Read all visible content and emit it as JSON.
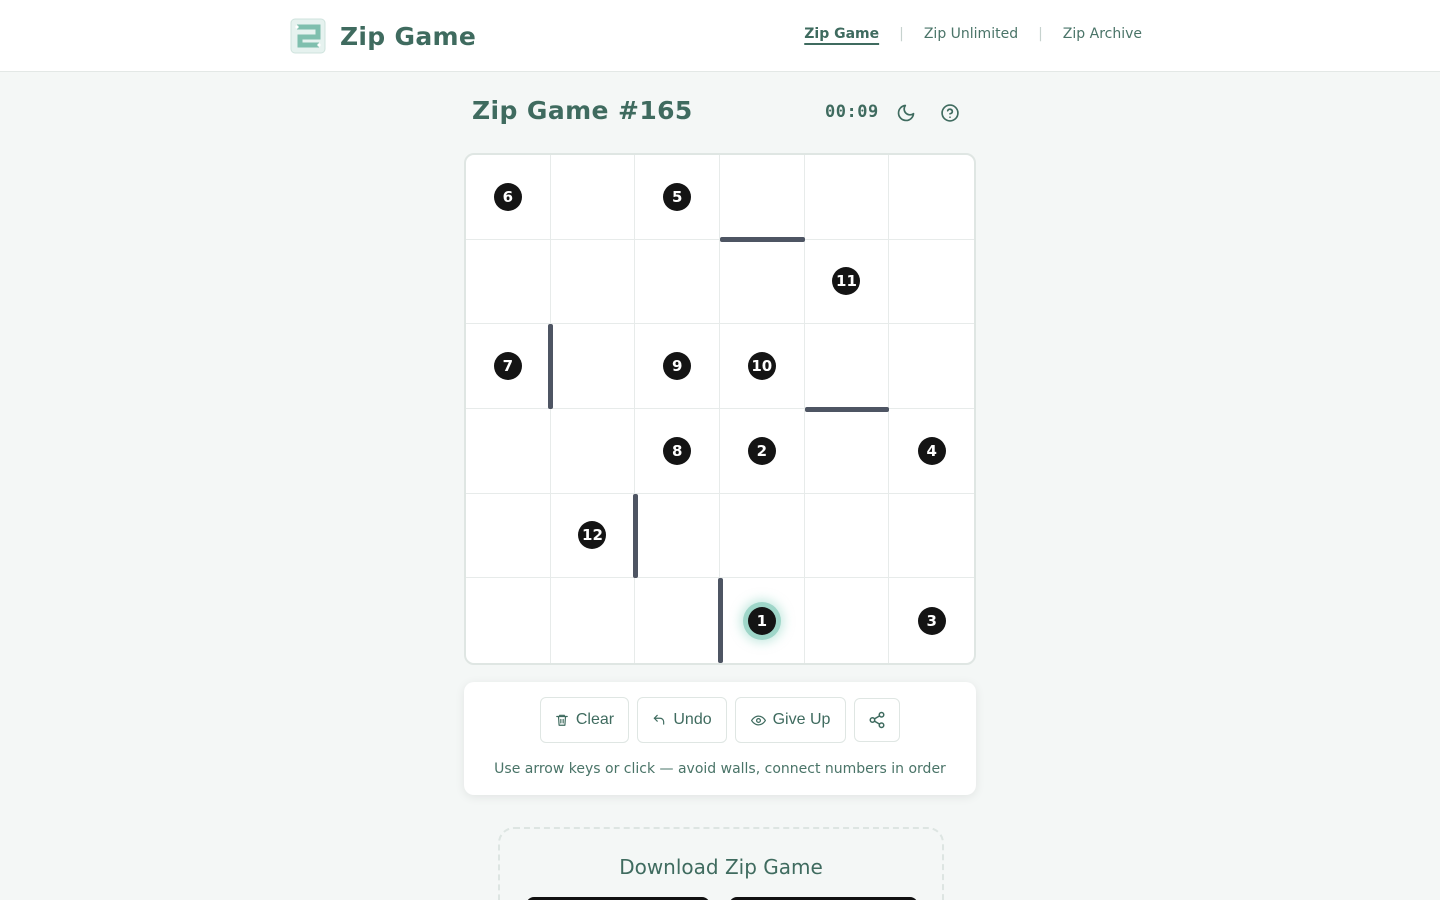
{
  "header": {
    "brand": "Zip Game",
    "nav": [
      {
        "label": "Zip Game",
        "active": true
      },
      {
        "label": "Zip Unlimited",
        "active": false
      },
      {
        "label": "Zip Archive",
        "active": false
      }
    ]
  },
  "game": {
    "title": "Zip Game #165",
    "timer": "00:09",
    "theme_icon": "moon-icon",
    "help_icon": "help-circle-icon",
    "grid_size": 6,
    "numbers": [
      {
        "row": 0,
        "col": 0,
        "n": "6"
      },
      {
        "row": 0,
        "col": 2,
        "n": "5"
      },
      {
        "row": 1,
        "col": 4,
        "n": "11"
      },
      {
        "row": 2,
        "col": 0,
        "n": "7"
      },
      {
        "row": 2,
        "col": 2,
        "n": "9"
      },
      {
        "row": 2,
        "col": 3,
        "n": "10"
      },
      {
        "row": 3,
        "col": 2,
        "n": "8"
      },
      {
        "row": 3,
        "col": 3,
        "n": "2"
      },
      {
        "row": 3,
        "col": 5,
        "n": "4"
      },
      {
        "row": 4,
        "col": 1,
        "n": "12"
      },
      {
        "row": 5,
        "col": 3,
        "n": "1",
        "start": true
      },
      {
        "row": 5,
        "col": 5,
        "n": "3"
      }
    ],
    "walls": [
      {
        "type": "h",
        "row": 0,
        "col": 3
      },
      {
        "type": "h",
        "row": 2,
        "col": 4
      },
      {
        "type": "v",
        "row": 2,
        "col": 0
      },
      {
        "type": "v",
        "row": 4,
        "col": 1
      },
      {
        "type": "v",
        "row": 5,
        "col": 2
      }
    ]
  },
  "controls": {
    "clear_label": "Clear",
    "undo_label": "Undo",
    "giveup_label": "Give Up",
    "share_icon": "share-icon",
    "hint": "Use arrow keys or click — avoid walls, connect numbers in order"
  },
  "download": {
    "title": "Download Zip Game"
  },
  "colors": {
    "accent": "#3f6b5f",
    "badge": "#141414",
    "wall": "#4e5563",
    "start_glow": "#8ccdbe"
  }
}
